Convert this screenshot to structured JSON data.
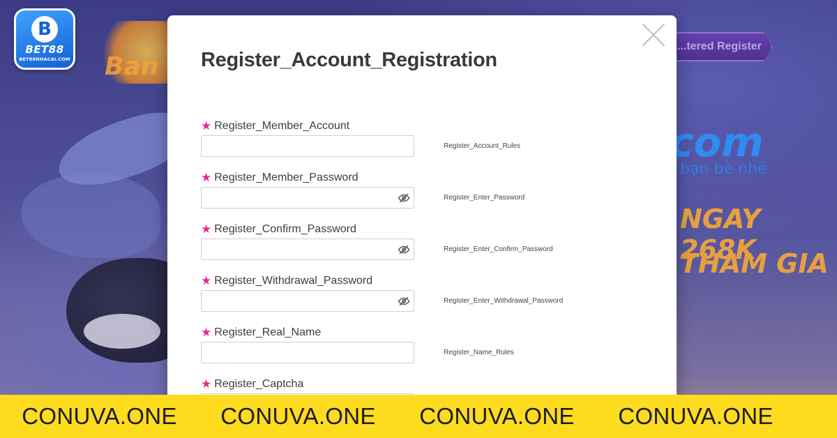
{
  "brand": {
    "mark": "B",
    "name": "BET88",
    "sub": "BET88NHACAI.COM"
  },
  "background": {
    "game_text": "Ban",
    "register_button": "...tered Register",
    "big_text": "com",
    "line1": "bạn bè nhé",
    "line2": "NGAY 268K",
    "line3": "THAM GIA"
  },
  "modal": {
    "title": "Register_Account_Registration",
    "fields": [
      {
        "label": "Register_Member_Account",
        "hint": "Register_Account_Rules",
        "value": "",
        "has_eye": false
      },
      {
        "label": "Register_Member_Password",
        "hint": "Register_Enter_Password",
        "value": "",
        "has_eye": true
      },
      {
        "label": "Register_Confirm_Password",
        "hint": "Register_Enter_Confirm_Password",
        "value": "",
        "has_eye": true
      },
      {
        "label": "Register_Withdrawal_Password",
        "hint": "Register_Enter_Withdrawal_Password",
        "value": "",
        "has_eye": true
      },
      {
        "label": "Register_Real_Name",
        "hint": "Register_Name_Rules",
        "value": "",
        "has_eye": false
      },
      {
        "label": "Register_Captcha",
        "hint": "",
        "value": "",
        "has_eye": false
      }
    ],
    "required_icon": "star-icon",
    "toggle_icon": "eye-slash-icon",
    "required_color": "#e6288e"
  },
  "banner": {
    "items": [
      "CONUVA.ONE",
      "CONUVA.ONE",
      "CONUVA.ONE",
      "CONUVA.ONE"
    ],
    "background": "#fddb1f"
  }
}
